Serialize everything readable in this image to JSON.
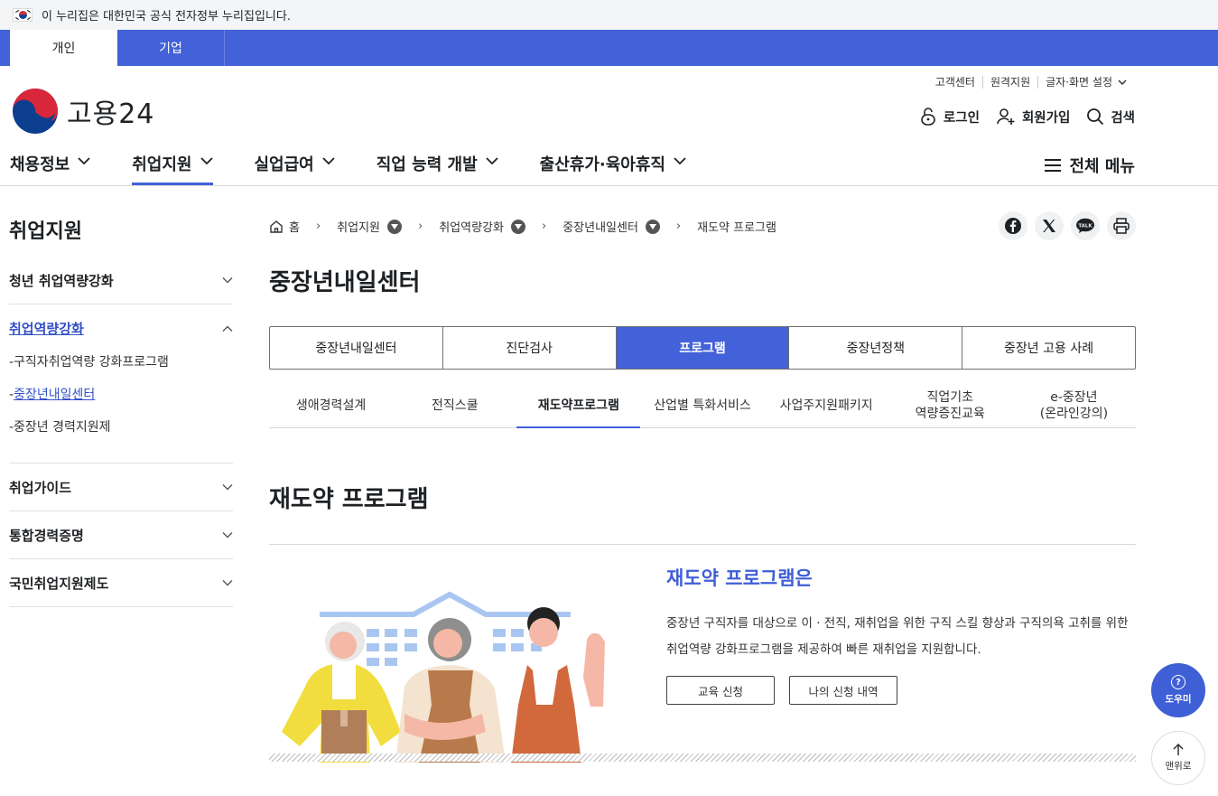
{
  "gov_banner": {
    "text": "이 누리집은 대한민국 공식 전자정부 누리집입니다."
  },
  "user_tabs": {
    "personal": "개인",
    "corporate": "기업"
  },
  "logo": {
    "text": "고용24"
  },
  "util_links": [
    "고객센터",
    "원격지원",
    "글자·화면 설정"
  ],
  "member_links": {
    "login": "로그인",
    "signup": "회원가입",
    "search": "검색"
  },
  "gnb": {
    "items": [
      "채용정보",
      "취업지원",
      "실업급여",
      "직업 능력 개발",
      "출산휴가·육아휴직"
    ],
    "active_index": 1,
    "all_menu": "전체 메뉴"
  },
  "sidebar": {
    "title": "취업지원",
    "items": [
      {
        "label": "청년 취업역량강화"
      },
      {
        "label": "취업역량강화",
        "open": true,
        "sub": [
          "-구직자취업역량 강화프로그램",
          "-",
          "중장년내일센터",
          "-중장년 경력지원제"
        ]
      },
      {
        "label": "취업가이드"
      },
      {
        "label": "통합경력증명"
      },
      {
        "label": "국민취업지원제도"
      }
    ]
  },
  "breadcrumb": [
    "홈",
    "취업지원",
    "취업역량강화",
    "중장년내일센터",
    "재도약 프로그램"
  ],
  "share_icons": [
    "facebook-icon",
    "x-icon",
    "kakaotalk-icon",
    "print-icon"
  ],
  "page_title": "중장년내일센터",
  "main_tabs": [
    "중장년내일센터",
    "진단검사",
    "프로그램",
    "중장년정책",
    "중장년 고용 사례"
  ],
  "main_tab_active": 2,
  "sub_tabs": [
    "생애경력설계",
    "전직스쿨",
    "재도약프로그램",
    "산업별 특화서비스",
    "사업주지원패키지",
    "직업기초\n역량증진교육",
    "e-중장년\n(온라인강의)"
  ],
  "sub_tab_active": 2,
  "section_title": "재도약 프로그램",
  "intro": {
    "heading": "재도약 프로그램은",
    "text": "중장년 구직자를 대상으로 이 · 전직, 재취업을 위한 구직 스킬 향상과 구직의욕 고취를 위한 취업역량 강화프로그램을 제공하여 빠른 재취업을 지원합니다.",
    "apply_button": "교육 신청",
    "history_button": "나의 신청 내역"
  },
  "floating": {
    "help": "도우미",
    "help_mark": "?",
    "top": "맨위로"
  },
  "colors": {
    "primary": "#4361d8",
    "heading_blue": "#3f5fd6"
  }
}
